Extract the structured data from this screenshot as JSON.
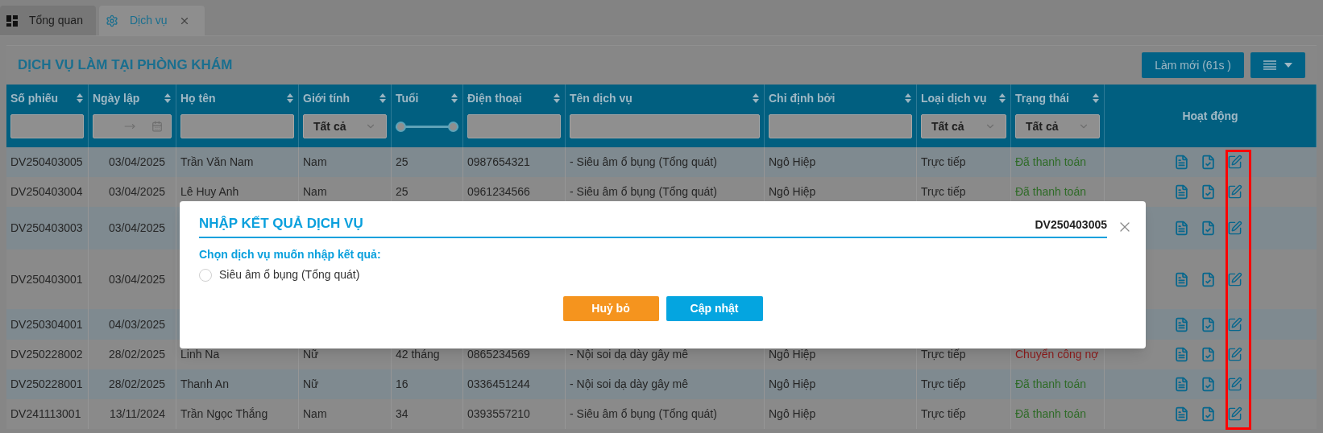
{
  "tabs": [
    {
      "label": "Tổng quan",
      "kind": "dashboard",
      "selected": false,
      "closable": false
    },
    {
      "label": "Dịch vụ",
      "kind": "settings",
      "selected": true,
      "closable": true
    }
  ],
  "page_title": "DỊCH VỤ LÀM TẠI PHÒNG KHÁM",
  "refresh_button": "Làm mới (61s )",
  "columns": [
    {
      "label": "Số phiếu",
      "kind": "text",
      "sortable": true
    },
    {
      "label": "Ngày lập",
      "kind": "date",
      "sortable": true
    },
    {
      "label": "Họ tên",
      "kind": "text",
      "sortable": true
    },
    {
      "label": "Giới tính",
      "kind": "select",
      "value": "Tất cả",
      "sortable": true
    },
    {
      "label": "Tuổi",
      "kind": "range",
      "level": 1,
      "sortable": true
    },
    {
      "label": "Điện thoại",
      "kind": "text",
      "sortable": true
    },
    {
      "label": "Tên dịch vụ",
      "kind": "text",
      "sortable": true
    },
    {
      "label": "Chỉ định bởi",
      "kind": "text",
      "sortable": true
    },
    {
      "label": "Loại dịch vụ",
      "kind": "select",
      "value": "Tất cả",
      "sortable": true
    },
    {
      "label": "Trạng thái",
      "kind": "select",
      "value": "Tất cả",
      "sortable": true
    },
    {
      "label": "Hoạt động",
      "kind": "plain",
      "sortable": false
    }
  ],
  "rows": [
    {
      "cells": [
        "DV250403005",
        "03/04/2025",
        "Trần Văn Nam",
        "Nam",
        "25",
        "0987654321",
        "- Siêu âm ổ bụng (Tổng quát)",
        "Ngô Hiệp",
        "Trực tiếp",
        "Đã thanh toán"
      ],
      "color": "#2f6b27"
    },
    {
      "cells": [
        "DV250403004",
        "03/04/2025",
        "Lê Huy Anh",
        "Nam",
        "25",
        "0961234566",
        "- Siêu âm ổ bụng (Tổng quát)",
        "Ngô Hiệp",
        "Trực tiếp",
        "Đã thanh toán"
      ],
      "color": "#2f6b27"
    },
    {
      "cells": [
        "DV250403003",
        "03/04/2025"
      ]
    },
    {
      "cells": [
        "DV250403001",
        "03/04/2025"
      ]
    },
    {
      "cells": [
        "DV250304001",
        "04/03/2025"
      ]
    },
    {
      "cells": [
        "DV250228002",
        "28/02/2025",
        "Linh Na",
        "Nữ",
        "42 tháng",
        "0865234569",
        "- Nội soi dạ dày gây mê",
        "Ngô Hiệp",
        "Trực tiếp",
        "Chuyển công nợ"
      ],
      "color": "#8e1b1b"
    },
    {
      "cells": [
        "DV250228001",
        "28/02/2025",
        "Thanh An",
        "Nữ",
        "16",
        "0336451244",
        "- Nội soi dạ dày gây mê",
        "Ngô Hiệp",
        "Trực tiếp",
        "Đã thanh toán"
      ],
      "color": "#2f6b27"
    },
    {
      "cells": [
        "DV241113001",
        "13/11/2024",
        "Trần Ngọc Thắng",
        "Nam",
        "34",
        "0393557210",
        "- Siêu âm ổ bụng (Tổng quát)",
        "Ngô Hiệp",
        "Trực tiếp",
        "Đã thanh toán"
      ],
      "color": "#2f6b27"
    }
  ],
  "highlight_edit_column": true,
  "dialog": {
    "title": "NHẬP KẾT QUẢ DỊCH VỤ",
    "code": "DV250403005",
    "prompt": "Chọn dịch vụ muốn nhập kết quả:",
    "options": [
      {
        "label": "Siêu âm ổ bụng (Tổng quát)",
        "selected": false
      }
    ],
    "cancel_button": "Huỷ bỏ",
    "submit_button": "Cập nhật"
  }
}
